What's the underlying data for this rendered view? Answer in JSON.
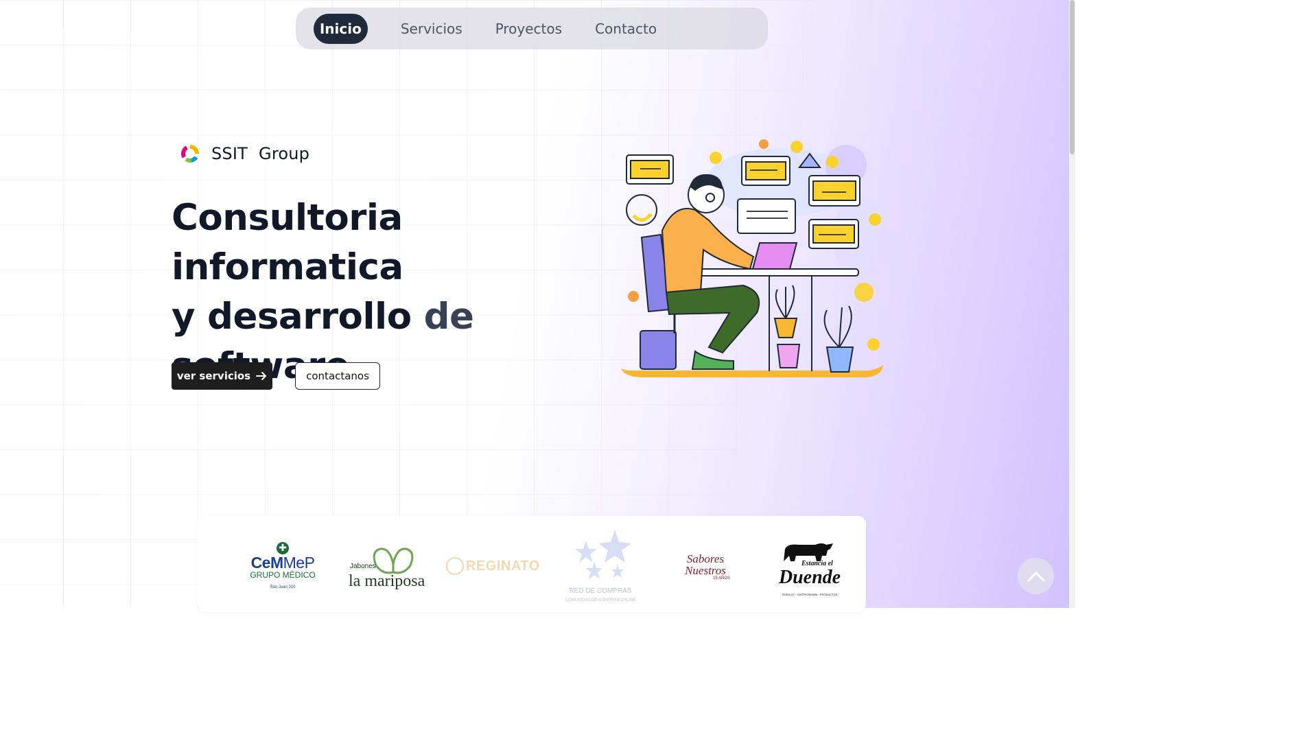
{
  "nav": {
    "items": [
      {
        "label": "Inicio",
        "active": true
      },
      {
        "label": "Servicios",
        "active": false
      },
      {
        "label": "Proyectos",
        "active": false
      },
      {
        "label": "Contacto",
        "active": false
      }
    ]
  },
  "brand": {
    "part1": "SSIT",
    "part2": "Group",
    "logo_icon": "ring-logo-icon"
  },
  "hero": {
    "title_line1": "Consultoria informatica",
    "title_line2_dark": "y desarrollo ",
    "title_line2_muted": "de",
    "title_line3": "software",
    "primary_button": "ver servicios",
    "primary_button_icon": "arrow-right-icon",
    "secondary_button": "contactanos"
  },
  "clients": {
    "cemmep": {
      "line1_a": "CeM",
      "line1_b": "MeP",
      "line2": "GRUPO MÉDICO",
      "line3": "San Juan 310"
    },
    "mariposa": {
      "small": "Jabones",
      "big": "la mariposa"
    },
    "reginato": {
      "name": "REGINATO"
    },
    "red": {
      "line1": "RED DE COMPRAS",
      "line2": "COMUNIDAD DE COMPRAS ONLINE"
    },
    "sabores": {
      "line1": "Sabores",
      "line2": "Nuestros",
      "line3": "15 AÑOS"
    },
    "duende": {
      "line1": "Estancia el",
      "line2": "Duende",
      "line3": "FEEDLOT · GASTRONOMÍA · PRODUCTOS"
    }
  },
  "colors": {
    "accent": "#1f2a3a",
    "button_dark": "#1f1f1f",
    "glow": "#cebeff"
  },
  "scroll_top_icon": "chevron-up-icon"
}
